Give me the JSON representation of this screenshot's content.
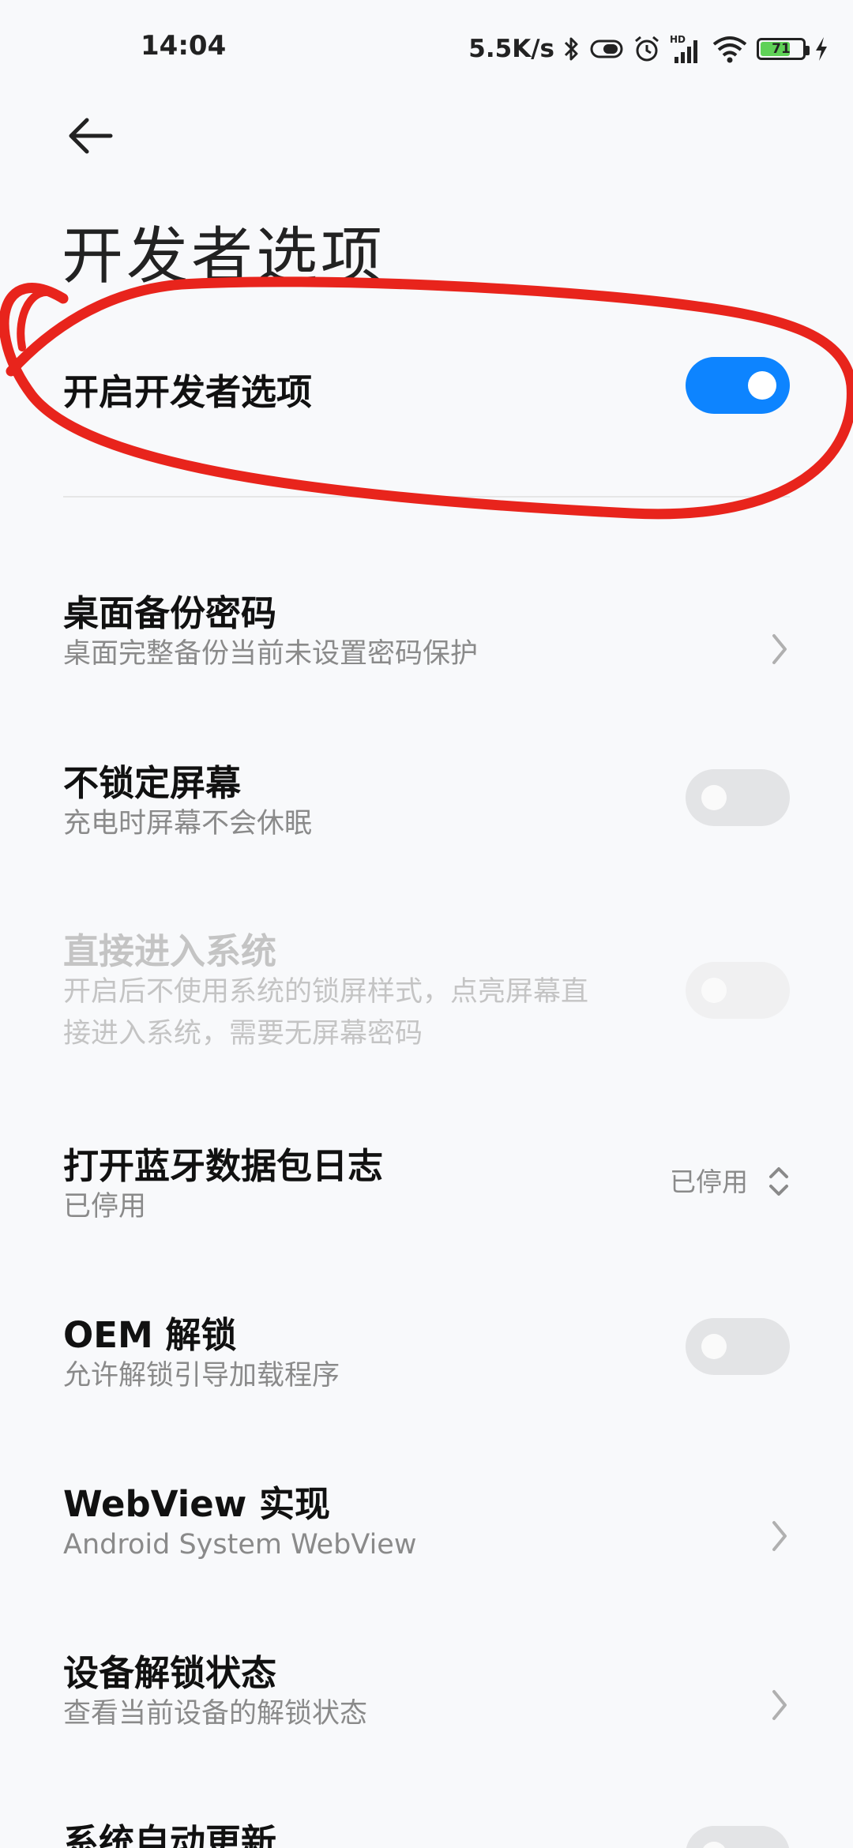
{
  "status_bar": {
    "time": "14:04",
    "net_speed": "5.5K/s",
    "battery_level": "71",
    "battery_fraction": 0.71,
    "icons": [
      "bluetooth-icon",
      "toggle-status-icon",
      "alarm-icon",
      "hd-signal-icon",
      "wifi-icon",
      "battery-icon",
      "charging-icon"
    ]
  },
  "header": {
    "title": "开发者选项",
    "back_icon": "back-arrow-icon"
  },
  "settings": [
    {
      "title": "开启开发者选项",
      "control": "toggle",
      "on": true
    },
    {
      "title": "桌面备份密码",
      "subtitle": "桌面完整备份当前未设置密码保护",
      "control": "chevron"
    },
    {
      "title": "不锁定屏幕",
      "subtitle": "充电时屏幕不会休眠",
      "control": "toggle",
      "on": false
    },
    {
      "title": "直接进入系统",
      "subtitle_line1": "开启后不使用系统的锁屏样式，点亮屏幕直",
      "subtitle_line2": "接进入系统，需要无屏幕密码",
      "control": "toggle",
      "on": false,
      "disabled": true
    },
    {
      "title": "打开蓝牙数据包日志",
      "subtitle": "已停用",
      "control": "select",
      "value": "已停用"
    },
    {
      "title": "OEM 解锁",
      "subtitle": "允许解锁引导加载程序",
      "control": "toggle",
      "on": false
    },
    {
      "title": "WebView 实现",
      "subtitle": "Android System WebView",
      "control": "chevron"
    },
    {
      "title": "设备解锁状态",
      "subtitle": "查看当前设备的解锁状态",
      "control": "chevron"
    },
    {
      "title": "系统自动更新",
      "control": "toggle",
      "on": false
    }
  ],
  "colors": {
    "accent": "#0d84ff",
    "annotation": "#e8241c",
    "background": "#f8f9fb"
  }
}
